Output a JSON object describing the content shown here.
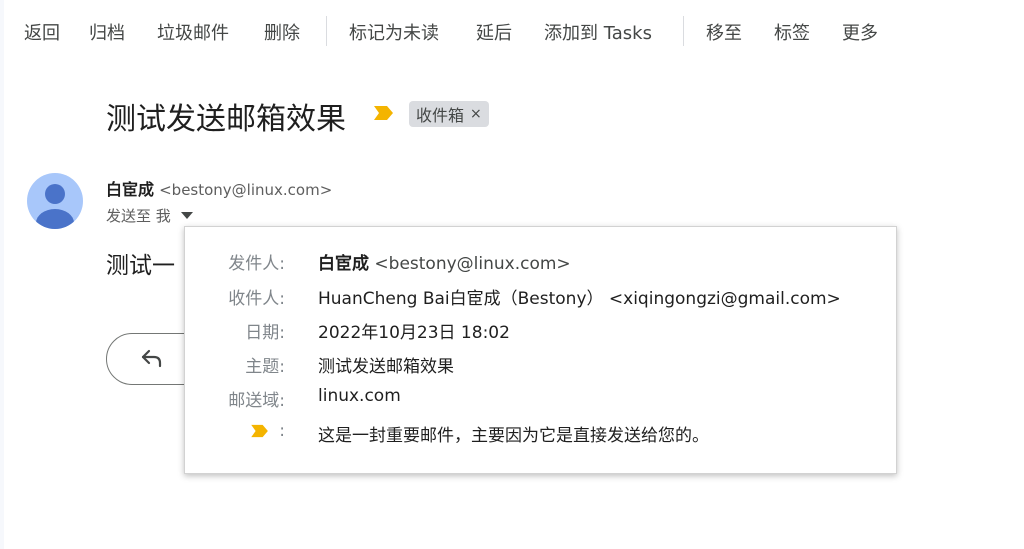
{
  "toolbar": {
    "back": "返回",
    "archive": "归档",
    "spam": "垃圾邮件",
    "delete": "删除",
    "mark_unread": "标记为未读",
    "snooze": "延后",
    "add_to_tasks": "添加到 Tasks",
    "move_to": "移至",
    "labels": "标签",
    "more": "更多"
  },
  "message": {
    "subject": "测试发送邮箱效果",
    "label_chip": "收件箱",
    "label_chip_close": "×",
    "sender_name": "白宦成",
    "sender_email": "<bestony@linux.com>",
    "to_text": "发送至 我",
    "body_preview": "测试一",
    "importance_color": "#f4b400",
    "avatar_color": "#a8c7fa",
    "avatar_figure_color": "#4a73c9"
  },
  "details": {
    "from_label": "发件人:",
    "from_name": "白宦成",
    "from_email": "<bestony@linux.com>",
    "to_label": "收件人:",
    "to_value": "HuanCheng Bai白宦成（Bestony） <xiqingongzi@gmail.com>",
    "date_label": "日期:",
    "date_value": "2022年10月23日 18:02",
    "subject_label": "主题:",
    "subject_value": "测试发送邮箱效果",
    "mailed_by_label": "邮送域:",
    "mailed_by_value": "linux.com",
    "importance_colon": ":",
    "importance_value": "这是一封重要邮件，主要因为它是直接发送给您的。"
  }
}
